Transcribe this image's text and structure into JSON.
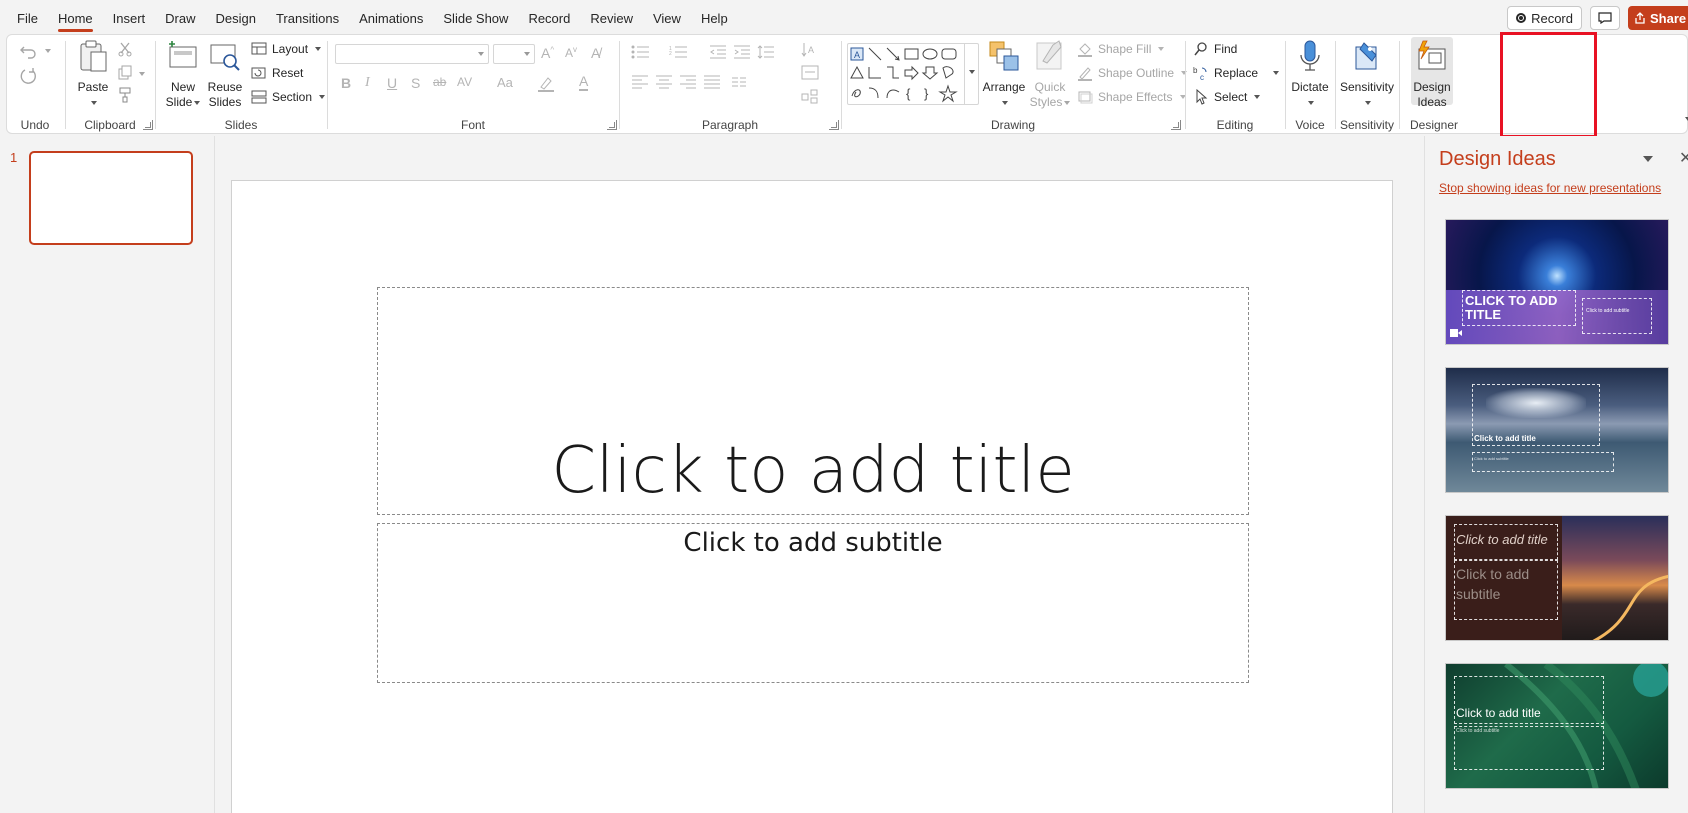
{
  "menu": {
    "items": [
      "File",
      "Home",
      "Insert",
      "Draw",
      "Design",
      "Transitions",
      "Animations",
      "Slide Show",
      "Record",
      "Review",
      "View",
      "Help"
    ],
    "active": "Home",
    "record_label": "Record",
    "share_label": "Share"
  },
  "ribbon": {
    "undo": {
      "label": "Undo"
    },
    "clipboard": {
      "label": "Clipboard",
      "paste": "Paste"
    },
    "slides": {
      "label": "Slides",
      "new_slide": "New Slide",
      "new_slide_l1": "New",
      "new_slide_l2": "Slide",
      "reuse_l1": "Reuse",
      "reuse_l2": "Slides",
      "layout": "Layout",
      "reset": "Reset",
      "section": "Section"
    },
    "font": {
      "label": "Font"
    },
    "paragraph": {
      "label": "Paragraph"
    },
    "drawing": {
      "label": "Drawing",
      "arrange": "Arrange",
      "quick_l1": "Quick",
      "quick_l2": "Styles",
      "shape_fill": "Shape Fill",
      "shape_outline": "Shape Outline",
      "shape_effects": "Shape Effects"
    },
    "editing": {
      "label": "Editing",
      "find": "Find",
      "replace": "Replace",
      "select": "Select"
    },
    "voice": {
      "label": "Voice",
      "dictate": "Dictate"
    },
    "sensitivity": {
      "label": "Sensitivity",
      "button": "Sensitivity"
    },
    "designer": {
      "label": "Designer",
      "btn_l1": "Design",
      "btn_l2": "Ideas"
    }
  },
  "thumbnails": {
    "number": "1"
  },
  "slide": {
    "title_placeholder": "Click to add title",
    "subtitle_placeholder": "Click to add subtitle"
  },
  "design_pane": {
    "title": "Design Ideas",
    "link": "Stop showing ideas for new presentations",
    "ideas": [
      {
        "title": "CLICK TO ADD TITLE",
        "subtitle": "Click to add subtitle"
      },
      {
        "title": "Click to add title",
        "subtitle": "Click to add subtitle"
      },
      {
        "title": "Click to add title",
        "subtitle": "Click to add subtitle"
      },
      {
        "title": "Click to add title",
        "subtitle": "Click to add subtitle"
      }
    ]
  },
  "colors": {
    "accent": "#c43e1c",
    "highlight": "#e81123",
    "brand_orange": "#d24726"
  }
}
